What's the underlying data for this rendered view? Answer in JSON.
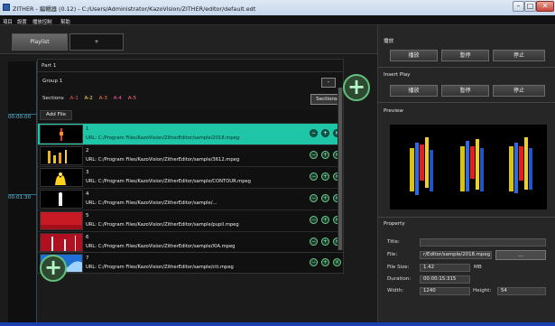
{
  "window": {
    "title": "ZITHER - 編輯器 (0.12) - C:/Users/Administrator/KazoVision/ZITHER/editor/default.edt"
  },
  "menu": [
    "項目",
    "設置",
    "播放控制",
    "幫助"
  ],
  "tabs": {
    "playlist": "Playlist",
    "add": "+"
  },
  "timeline": {
    "top_code": "00:00:00",
    "mid_code": "00:01:30"
  },
  "playlist": {
    "part_label": "Part 1",
    "group_label": "Group 1",
    "group_collapse": "-",
    "sections_label": "Sections",
    "sections": [
      "A-1",
      "A-2",
      "A-3",
      "A-4",
      "A-5"
    ],
    "sections_button": "Sections",
    "add_file": "Add File",
    "files": [
      {
        "num": "1",
        "url": "URL: C:/Program Files/KazoVision/ZitherEditor/sample/2018.mpeg",
        "thumb": "red-candle"
      },
      {
        "num": "2",
        "url": "URL: C:/Program Files/KazoVision/ZitherEditor/sample/3612.mpeg",
        "thumb": "yellow-bars"
      },
      {
        "num": "3",
        "url": "URL: C:/Program Files/KazoVision/ZitherEditor/sample/CONTOUR.mpeg",
        "thumb": "gold-figure"
      },
      {
        "num": "4",
        "url": "URL: C:/Program Files/KazoVision/ZitherEditor/sample/...",
        "thumb": "white-figure"
      },
      {
        "num": "5",
        "url": "URL: C:/Program Files/KazoVision/ZitherEditor/sample/pupil.mpeg",
        "thumb": "red-solid"
      },
      {
        "num": "6",
        "url": "URL: C:/Program Files/KazoVision/ZitherEditor/sample/XIA.mpeg",
        "thumb": "red-lines"
      },
      {
        "num": "7",
        "url": "URL: C:/Program Files/KazoVision/ZitherEditor/sample/ctt.mpeg",
        "thumb": "blue-wave"
      }
    ]
  },
  "right": {
    "playback_title": "播放",
    "playback_buttons": [
      "播放",
      "暫停",
      "停止"
    ],
    "insert_title": "Insert Play",
    "insert_buttons": [
      "播放",
      "暫停",
      "停止"
    ],
    "preview_title": "Preview",
    "property_title": "Property",
    "props": {
      "title_label": "Title:",
      "title_value": "",
      "file_label": "File:",
      "file_value": "r/Editor/sample/2018.mpeg",
      "browse": "...",
      "size_label": "File Size:",
      "size_value": "1.42",
      "size_unit": "MB",
      "duration_label": "Duration:",
      "duration_value": "00:00:15:315",
      "width_label": "Width:",
      "width_value": "1240",
      "height_label": "Height:",
      "height_value": "54"
    }
  },
  "colors": {
    "selected_row": "#1ec6a7",
    "accent_green": "#62c27c",
    "timecode": "#6bc0dd"
  }
}
